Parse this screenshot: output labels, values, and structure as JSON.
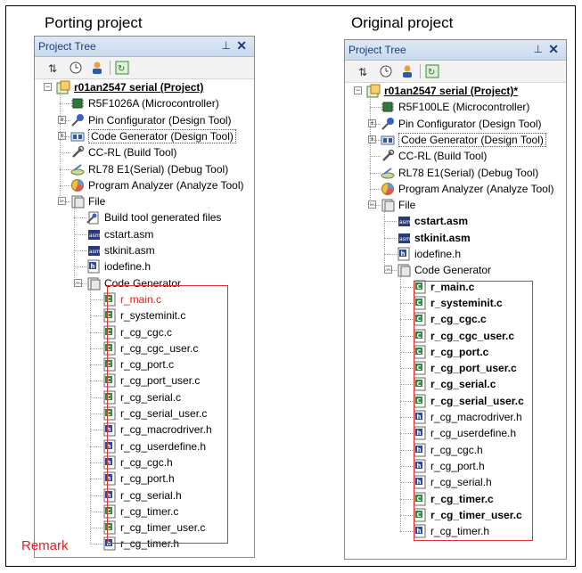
{
  "left": {
    "heading": "Porting project",
    "pane_title": "Project Tree",
    "pin": "ᵖ",
    "close": "✕",
    "project": "r01an2547 serial (Project)",
    "microcontroller": "R5F1026A (Microcontroller)",
    "pin_configurator": "Pin Configurator (Design Tool)",
    "code_generator_tool": "Code Generator (Design Tool)",
    "build_tool": "CC-RL (Build Tool)",
    "debug_tool": "RL78 E1(Serial) (Debug Tool)",
    "analyzer": "Program Analyzer (Analyze Tool)",
    "file": "File",
    "build_generated": "Build tool generated files",
    "files": [
      "cstart.asm",
      "stkinit.asm",
      "iodefine.h"
    ],
    "code_generator": "Code Generator",
    "cg_files": [
      "r_main.c",
      "r_systeminit.c",
      "r_cg_cgc.c",
      "r_cg_cgc_user.c",
      "r_cg_port.c",
      "r_cg_port_user.c",
      "r_cg_serial.c",
      "r_cg_serial_user.c",
      "r_cg_macrodriver.h",
      "r_cg_userdefine.h",
      "r_cg_cgc.h",
      "r_cg_port.h",
      "r_cg_serial.h",
      "r_cg_timer.c",
      "r_cg_timer_user.c",
      "r_cg_timer.h"
    ]
  },
  "right": {
    "heading": "Original project",
    "pane_title": "Project Tree",
    "pin": "ᵖ",
    "close": "✕",
    "project": "r01an2547 serial (Project)*",
    "microcontroller": "R5F100LE (Microcontroller)",
    "pin_configurator": "Pin Configurator (Design Tool)",
    "code_generator_tool": "Code Generator (Design Tool)",
    "build_tool": "CC-RL (Build Tool)",
    "debug_tool": "RL78 E1(Serial) (Debug Tool)",
    "analyzer": "Program Analyzer (Analyze Tool)",
    "file": "File",
    "files": [
      "cstart.asm",
      "stkinit.asm",
      "iodefine.h"
    ],
    "code_generator": "Code Generator",
    "cg_files": [
      "r_main.c",
      "r_systeminit.c",
      "r_cg_cgc.c",
      "r_cg_cgc_user.c",
      "r_cg_port.c",
      "r_cg_port_user.c",
      "r_cg_serial.c",
      "r_cg_serial_user.c",
      "r_cg_macrodriver.h",
      "r_cg_userdefine.h",
      "r_cg_cgc.h",
      "r_cg_port.h",
      "r_cg_serial.h",
      "r_cg_timer.c",
      "r_cg_timer_user.c",
      "r_cg_timer.h"
    ]
  },
  "remark": "Remark",
  "colors": {
    "highlight_box": "#e03030",
    "remark_text": "#e02020",
    "title_text": "#1d3d73"
  }
}
